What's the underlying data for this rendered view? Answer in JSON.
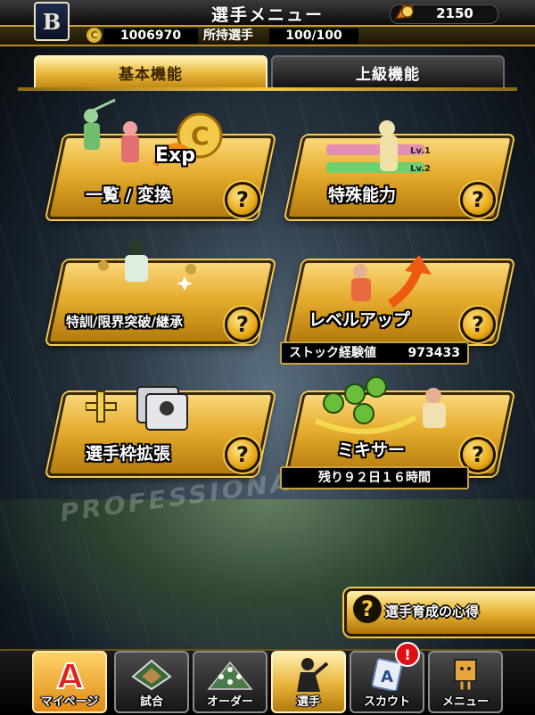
{
  "header": {
    "team_logo": "B",
    "title": "選手メニュー",
    "gems": "2150",
    "coins": "1006970",
    "owned_label": "所持選手",
    "owned_value": "100/100"
  },
  "tabs": [
    {
      "label": "基本機能",
      "active": true
    },
    {
      "label": "上級機能",
      "active": false
    }
  ],
  "menu": {
    "list_convert": {
      "label": "一覧 / 変換",
      "exp_text": "Exp"
    },
    "special_ability": {
      "label": "特殊能力",
      "lv1": "Lv.1",
      "lv2": "Lv.2"
    },
    "training": {
      "label": "特訓/限界突破/継承"
    },
    "level_up": {
      "label": "レベルアップ",
      "stock_label": "ストック経験値",
      "stock_value": "973433"
    },
    "expand": {
      "label": "選手枠拡張"
    },
    "mixer": {
      "label": "ミキサー",
      "remaining": "残り９２日１６時間"
    }
  },
  "help_glyph": "?",
  "guide": {
    "label": "選手育成の心得"
  },
  "background": {
    "logo_text": "PROFESSIONAL"
  },
  "nav": [
    {
      "label": "マイページ",
      "icon": "home-a-icon"
    },
    {
      "label": "試合",
      "icon": "stadium-icon"
    },
    {
      "label": "オーダー",
      "icon": "lineup-icon"
    },
    {
      "label": "選手",
      "icon": "player-icon",
      "active": true
    },
    {
      "label": "スカウト",
      "icon": "scout-icon",
      "badge": "!"
    },
    {
      "label": "メニュー",
      "icon": "menu-box-icon"
    }
  ],
  "colors": {
    "accent_gold": "#e6ad2e",
    "header_line": "#c9a030",
    "badge_red": "#e01010"
  }
}
